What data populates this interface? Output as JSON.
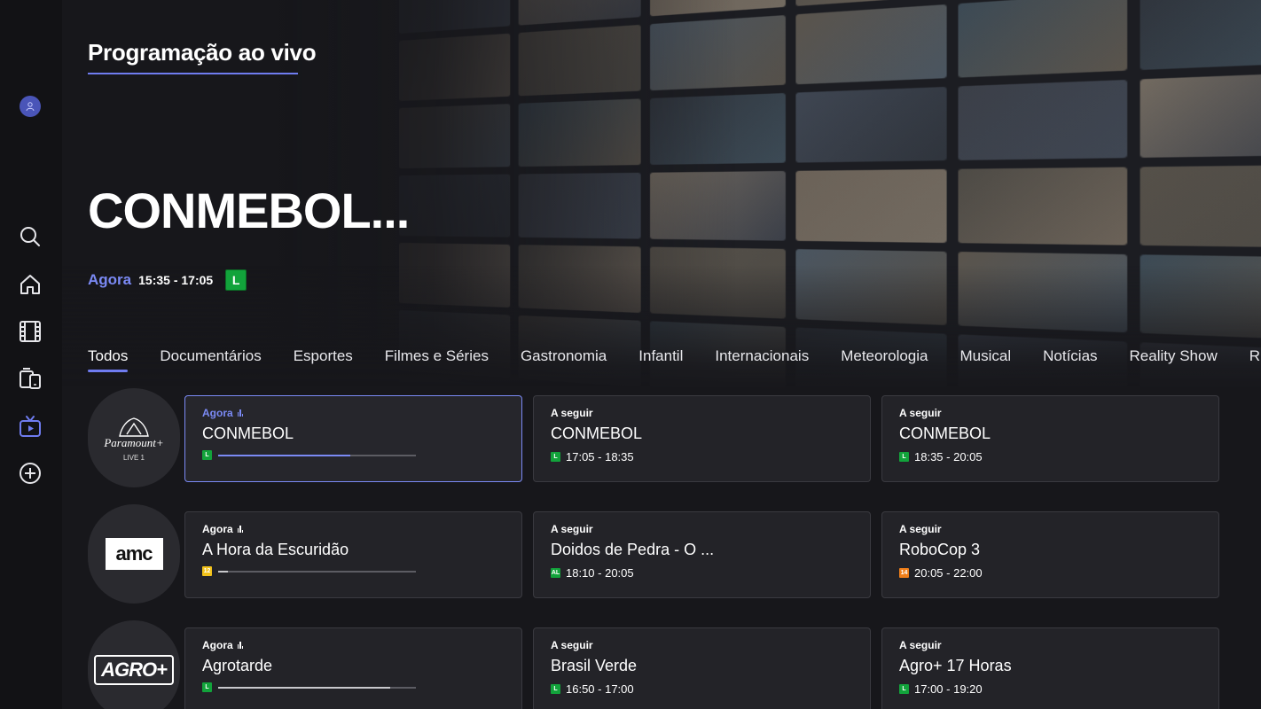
{
  "header": {
    "title": "Programação ao vivo"
  },
  "hero": {
    "title": "CONMEBOL...",
    "now_label": "Agora",
    "time": "15:35 - 17:05",
    "rating": "L",
    "rating_color": "#12a33b"
  },
  "sidebar": {
    "items": [
      {
        "icon": "user-avatar-icon"
      },
      {
        "icon": "search-icon"
      },
      {
        "icon": "home-icon"
      },
      {
        "icon": "film-icon"
      },
      {
        "icon": "devices-icon"
      },
      {
        "icon": "live-tv-icon",
        "active": true
      },
      {
        "icon": "add-circle-icon"
      }
    ]
  },
  "tabs": [
    "Todos",
    "Documentários",
    "Esportes",
    "Filmes e Séries",
    "Gastronomia",
    "Infantil",
    "Internacionais",
    "Meteorologia",
    "Musical",
    "Notícias",
    "Reality Show",
    "R"
  ],
  "rows": [
    {
      "channel": {
        "name": "Paramount+",
        "sub": "LIVE 1"
      },
      "cards": [
        {
          "status": "Agora",
          "title": "CONMEBOL",
          "rating": "L",
          "rating_color": "#12a33b",
          "progress": 0.67
        },
        {
          "status": "A seguir",
          "title": "CONMEBOL",
          "rating": "L",
          "rating_color": "#12a33b",
          "time": "17:05 - 18:35"
        },
        {
          "status": "A seguir",
          "title": "CONMEBOL",
          "rating": "L",
          "rating_color": "#12a33b",
          "time": "18:35 - 20:05"
        }
      ]
    },
    {
      "channel": {
        "name": "amc"
      },
      "cards": [
        {
          "status": "Agora",
          "title": "A Hora da Escuridão",
          "rating": "12",
          "rating_color": "#f2c21a",
          "progress": 0.05
        },
        {
          "status": "A seguir",
          "title": "Doidos de Pedra - O ...",
          "rating": "AL",
          "rating_color": "#12a33b",
          "time": "18:10 - 20:05"
        },
        {
          "status": "A seguir",
          "title": "RoboCop 3",
          "rating": "14",
          "rating_color": "#f07f1a",
          "time": "20:05 - 22:00"
        }
      ]
    },
    {
      "channel": {
        "name": "AGRO+"
      },
      "cards": [
        {
          "status": "Agora",
          "title": "Agrotarde",
          "rating": "L",
          "rating_color": "#12a33b",
          "progress": 0.87
        },
        {
          "status": "A seguir",
          "title": "Brasil Verde",
          "rating": "L",
          "rating_color": "#12a33b",
          "time": "16:50 - 17:00"
        },
        {
          "status": "A seguir",
          "title": "Agro+ 17 Horas",
          "rating": "L",
          "rating_color": "#12a33b",
          "time": "17:00 - 19:20"
        }
      ]
    }
  ],
  "colors": {
    "accent": "#6f7cf0",
    "now": "#7b8af5",
    "card_bg": "#232328",
    "page_bg": "#17171b"
  }
}
